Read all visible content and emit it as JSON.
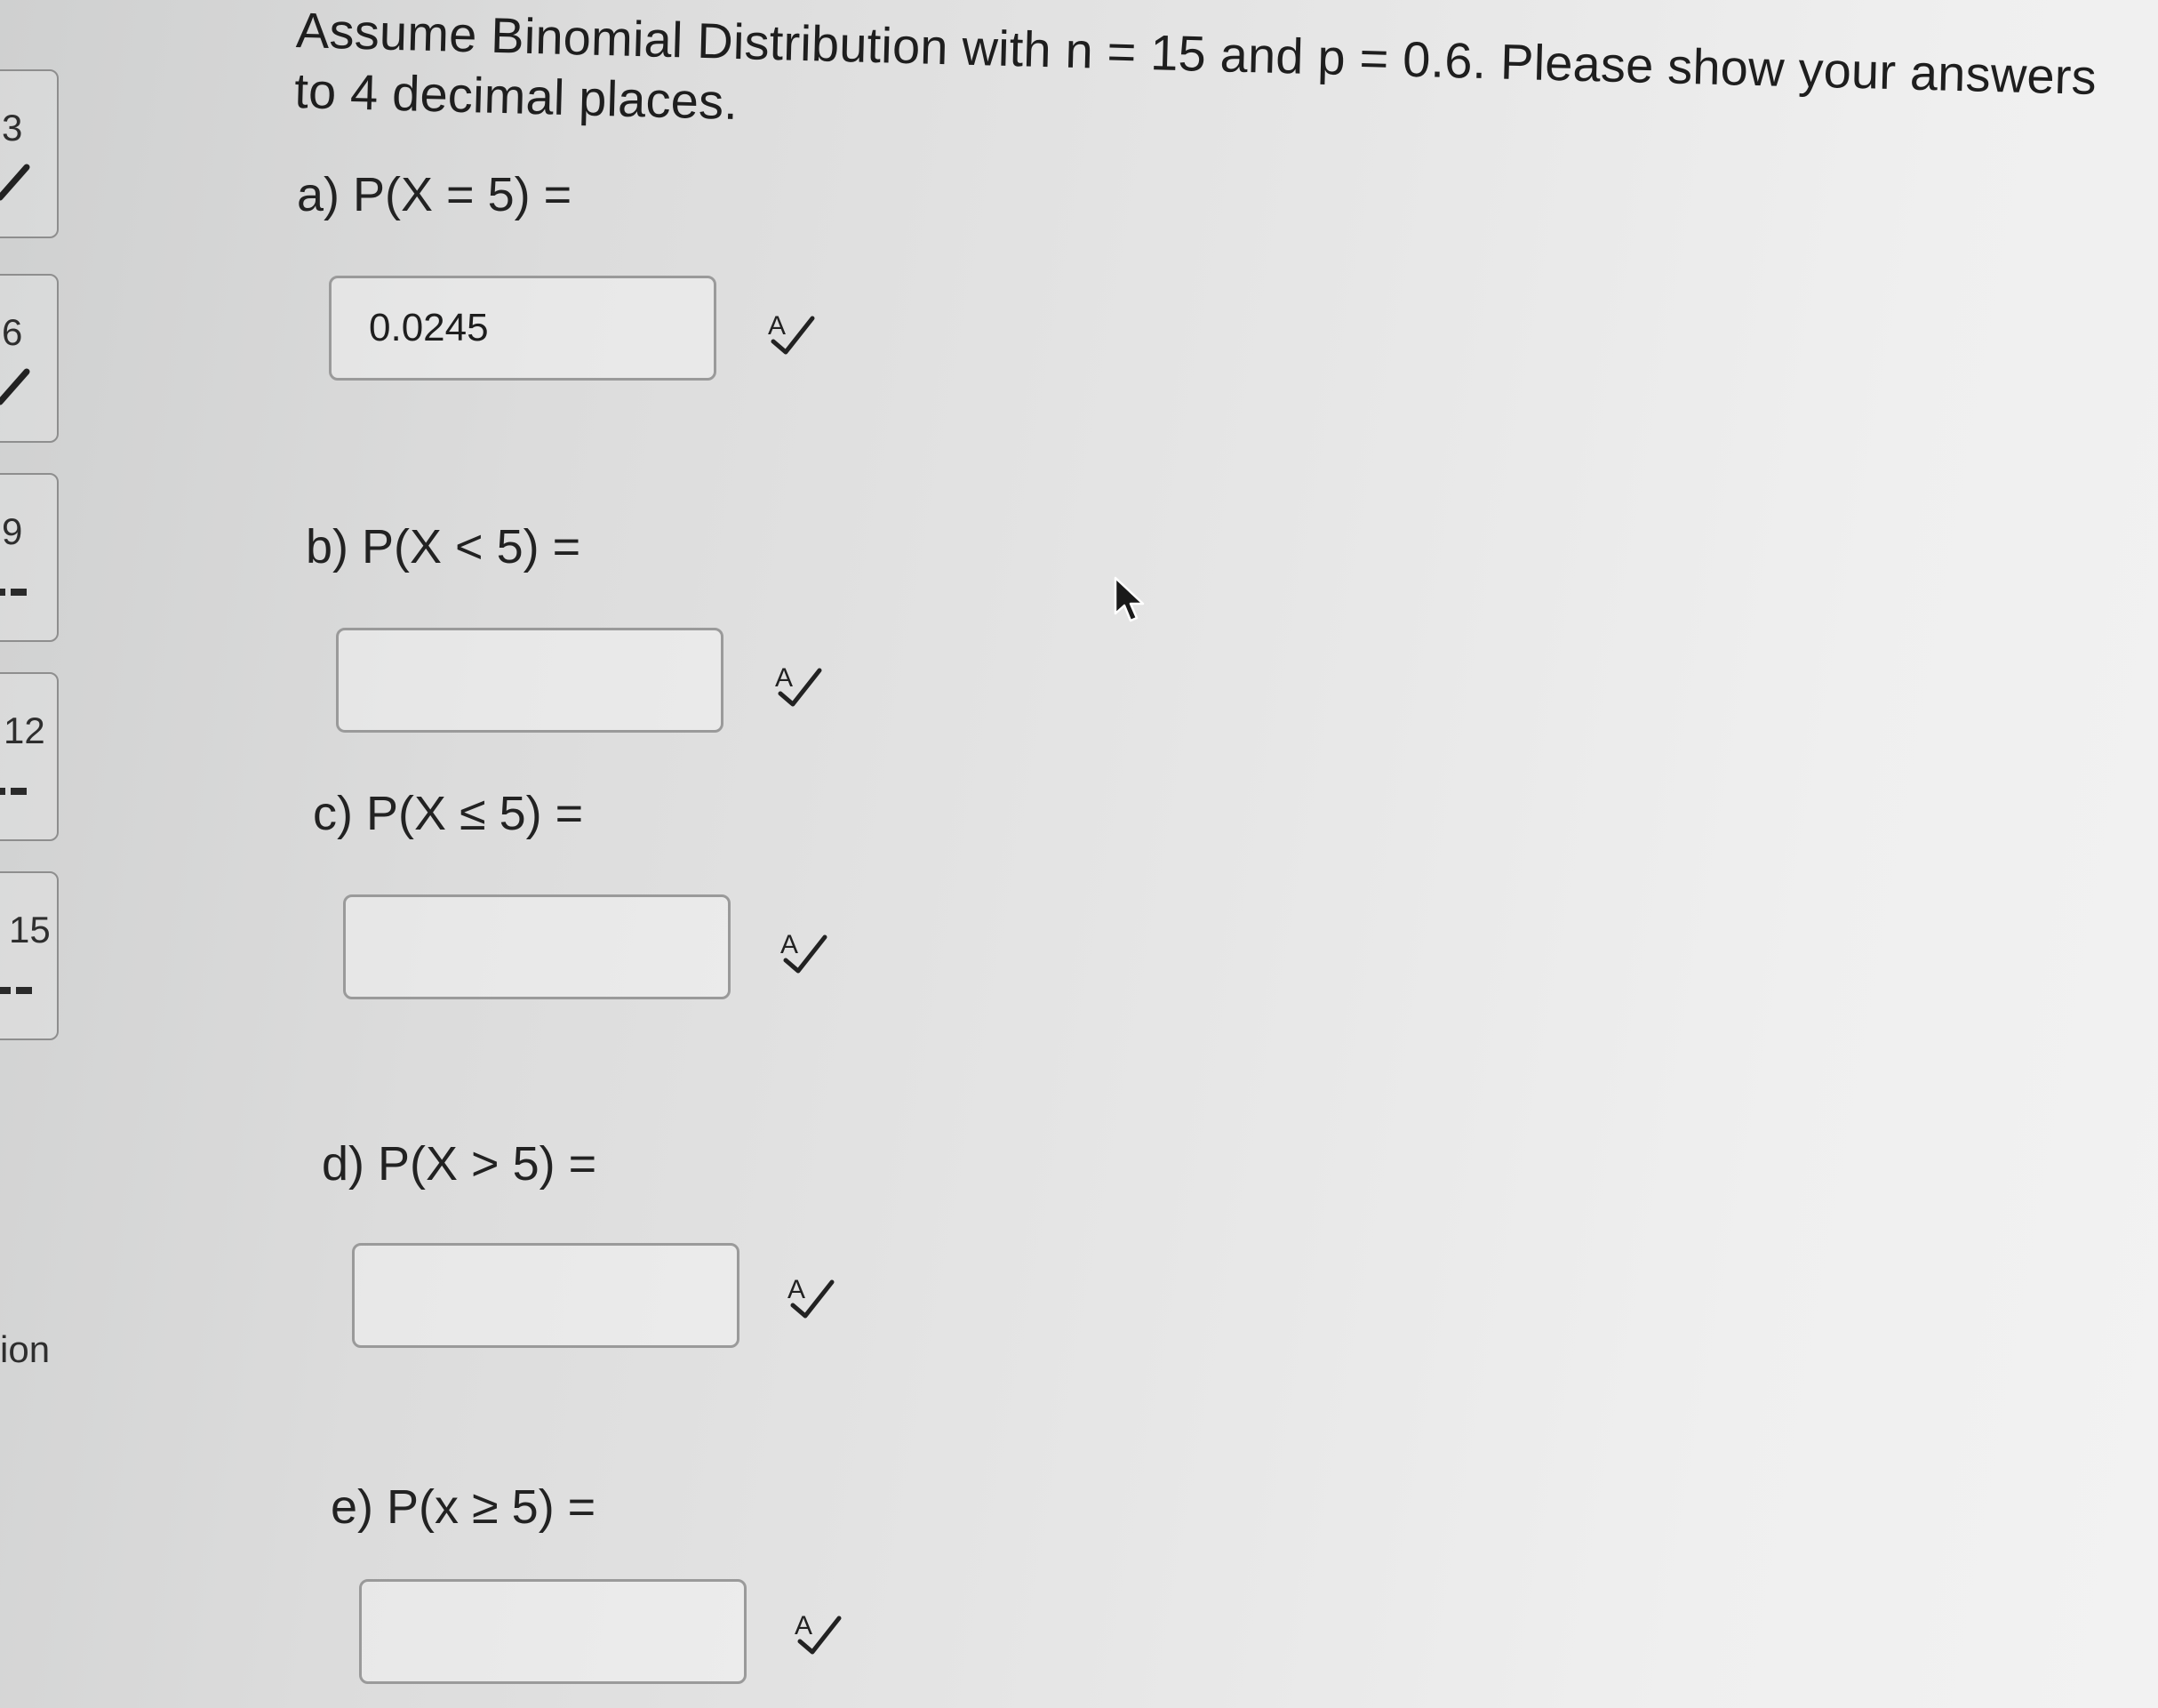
{
  "nav": {
    "tiles": [
      {
        "number": "3",
        "status": "check"
      },
      {
        "number": "6",
        "status": "check"
      },
      {
        "number": "9",
        "status": "unanswered"
      },
      {
        "number": "12",
        "status": "unanswered"
      },
      {
        "number": "15",
        "status": "unanswered"
      }
    ],
    "partial_label": "ion"
  },
  "question": {
    "intro": "Assume Binomial Distribution with n = 15 and p = 0.6. Please show your answers to 4 decimal places.",
    "parts": [
      {
        "label": "a) P(X = 5) =",
        "value": "0.0245"
      },
      {
        "label": "b) P(X < 5) =",
        "value": ""
      },
      {
        "label": "c) P(X ≤ 5) =",
        "value": ""
      },
      {
        "label": "d) P(X > 5) =",
        "value": ""
      },
      {
        "label": "e) P(x ≥ 5) =",
        "value": ""
      }
    ]
  },
  "icons": {
    "check": "check-icon",
    "spell": "spellcheck-icon",
    "cursor": "mouse-cursor-icon"
  }
}
